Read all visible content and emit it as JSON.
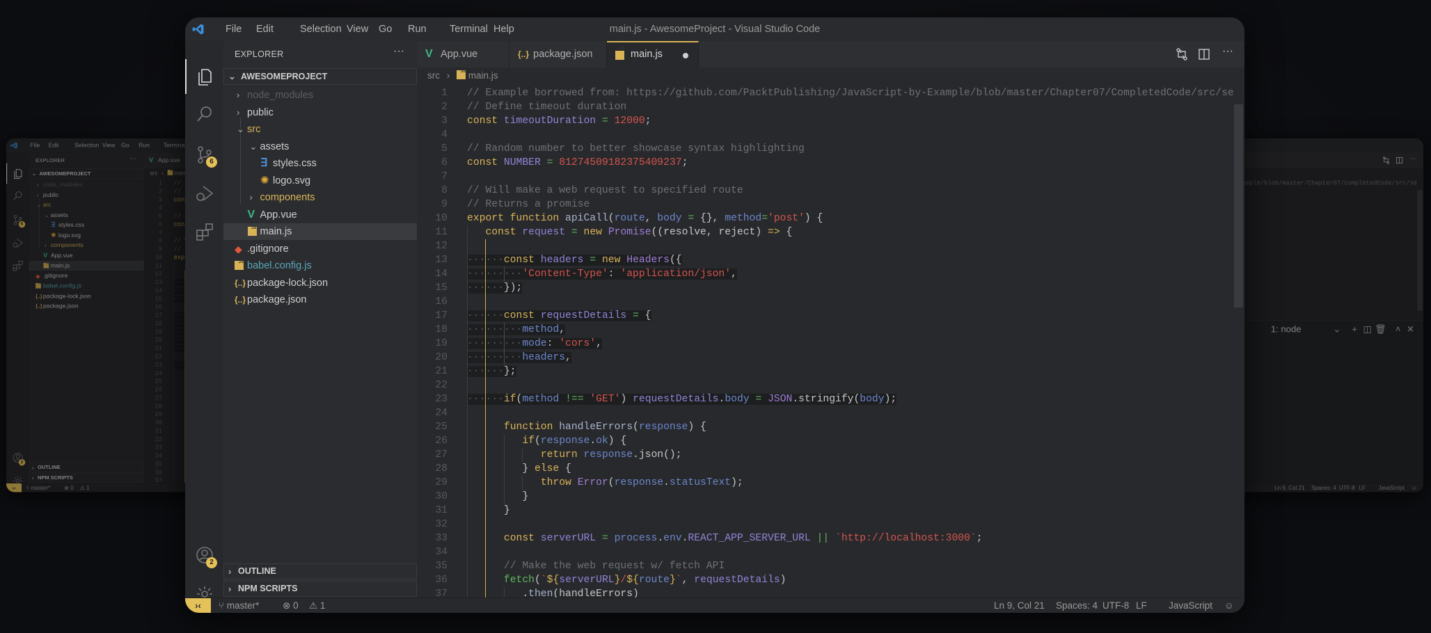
{
  "window": {
    "title": "main.js - AwesomeProject - Visual Studio Code"
  },
  "menu": [
    "File",
    "Edit",
    "Selection",
    "View",
    "Go",
    "Run",
    "Terminal",
    "Help"
  ],
  "activity_bar": {
    "items": [
      {
        "icon": "files-icon",
        "active": true
      },
      {
        "icon": "search-icon"
      },
      {
        "icon": "source-control-icon",
        "badge": "6"
      },
      {
        "icon": "run-debug-icon"
      },
      {
        "icon": "extensions-icon"
      }
    ],
    "bottom": [
      {
        "icon": "account-icon",
        "badge": "2"
      },
      {
        "icon": "gear-icon"
      }
    ]
  },
  "sidebar": {
    "title": "EXPLORER",
    "more": "···",
    "project": "AWESOMEPROJECT",
    "tree": [
      {
        "label": "node_modules",
        "type": "folder",
        "open": false,
        "level": 0,
        "color": "#5a5d62"
      },
      {
        "label": "public",
        "type": "folder",
        "open": false,
        "level": 0
      },
      {
        "label": "src",
        "type": "folder",
        "open": true,
        "level": 0,
        "color": "#d9b45a"
      },
      {
        "label": "assets",
        "type": "folder",
        "open": true,
        "level": 1
      },
      {
        "label": "styles.css",
        "type": "css",
        "level": 2
      },
      {
        "label": "logo.svg",
        "type": "svg",
        "level": 2
      },
      {
        "label": "components",
        "type": "folder",
        "open": false,
        "level": 1,
        "color": "#d9b45a"
      },
      {
        "label": "App.vue",
        "type": "vue",
        "level": 1
      },
      {
        "label": "main.js",
        "type": "js",
        "level": 1,
        "selected": true
      },
      {
        "label": ".gitignore",
        "type": "git",
        "level": 0
      },
      {
        "label": "babel.config.js",
        "type": "js",
        "level": 0,
        "color": "#5aa6b3"
      },
      {
        "label": "package-lock.json",
        "type": "json",
        "level": 0
      },
      {
        "label": "package.json",
        "type": "json",
        "level": 0
      }
    ],
    "panels": [
      "OUTLINE",
      "NPM SCRIPTS"
    ]
  },
  "tabs": [
    {
      "label": "App.vue",
      "type": "vue"
    },
    {
      "label": "package.json",
      "type": "json"
    },
    {
      "label": "main.js",
      "type": "js",
      "active": true,
      "modified": true
    }
  ],
  "breadcrumb": [
    "src",
    "main.js"
  ],
  "editor": {
    "lines": [
      [
        [
          "c",
          "// Example borrowed from: https://github.com/PacktPublishing/JavaScript-by-Example/blob/master/Chapter07/CompletedCode/src/se"
        ]
      ],
      [
        [
          "c",
          "// Define timeout duration"
        ]
      ],
      [
        [
          "k",
          "const"
        ],
        [
          "p",
          " "
        ],
        [
          "v",
          "timeoutDuration"
        ],
        [
          "p",
          " "
        ],
        [
          "o",
          "="
        ],
        [
          "p",
          " "
        ],
        [
          "n",
          "12000"
        ],
        [
          "p",
          ";"
        ]
      ],
      [],
      [
        [
          "c",
          "// Random number to better showcase syntax highlighting"
        ]
      ],
      [
        [
          "k",
          "const"
        ],
        [
          "p",
          " "
        ],
        [
          "v",
          "NUMBER"
        ],
        [
          "p",
          " "
        ],
        [
          "o",
          "="
        ],
        [
          "p",
          " "
        ],
        [
          "n",
          "81274509182375409237"
        ],
        [
          "p",
          ";"
        ]
      ],
      [],
      [
        [
          "c",
          "// Will make a web request to specified route"
        ]
      ],
      [
        [
          "c",
          "// Returns a promise"
        ]
      ],
      [
        [
          "k",
          "export function"
        ],
        [
          "p",
          " "
        ],
        [
          "f",
          "apiCall"
        ],
        [
          "p",
          "("
        ],
        [
          "t",
          "route"
        ],
        [
          "p",
          ", "
        ],
        [
          "t",
          "body"
        ],
        [
          "p",
          " "
        ],
        [
          "o",
          "="
        ],
        [
          "p",
          " {}, "
        ],
        [
          "t",
          "method"
        ],
        [
          "o",
          "="
        ],
        [
          "n",
          "'post'"
        ],
        [
          "p",
          ") {"
        ]
      ],
      [
        [
          "ws",
          "   "
        ],
        [
          "k",
          "const"
        ],
        [
          "p",
          " "
        ],
        [
          "v",
          "request"
        ],
        [
          "p",
          " "
        ],
        [
          "o",
          "="
        ],
        [
          "p",
          " "
        ],
        [
          "k",
          "new"
        ],
        [
          "p",
          " "
        ],
        [
          "cl2",
          "Promise"
        ],
        [
          "p",
          "((resolve, reject) "
        ],
        [
          "k",
          "=>"
        ],
        [
          "p",
          " {"
        ]
      ],
      [],
      [
        [
          "ws",
          "      "
        ],
        [
          "k",
          "const"
        ],
        [
          "p",
          " "
        ],
        [
          "v",
          "headers"
        ],
        [
          "p",
          " "
        ],
        [
          "o",
          "="
        ],
        [
          "p",
          " "
        ],
        [
          "k",
          "new"
        ],
        [
          "p",
          " "
        ],
        [
          "cl2",
          "Headers"
        ],
        [
          "p",
          "({"
        ]
      ],
      [
        [
          "ws",
          "         "
        ],
        [
          "n",
          "'Content-Type'"
        ],
        [
          "p",
          ": "
        ],
        [
          "n",
          "'application/json'"
        ],
        [
          "p",
          ","
        ]
      ],
      [
        [
          "ws",
          "      "
        ],
        [
          "p",
          "});"
        ]
      ],
      [],
      [
        [
          "ws",
          "      "
        ],
        [
          "k",
          "const"
        ],
        [
          "p",
          " "
        ],
        [
          "v",
          "requestDetails"
        ],
        [
          "p",
          " "
        ],
        [
          "o",
          "="
        ],
        [
          "p",
          " {"
        ]
      ],
      [
        [
          "ws",
          "         "
        ],
        [
          "t",
          "method"
        ],
        [
          "p",
          ","
        ]
      ],
      [
        [
          "ws",
          "         "
        ],
        [
          "t",
          "mode"
        ],
        [
          "p",
          ": "
        ],
        [
          "n",
          "'cors'"
        ],
        [
          "p",
          ","
        ]
      ],
      [
        [
          "ws",
          "         "
        ],
        [
          "t",
          "headers"
        ],
        [
          "p",
          ","
        ]
      ],
      [
        [
          "ws",
          "      "
        ],
        [
          "p",
          "};"
        ]
      ],
      [],
      [
        [
          "ws",
          "      "
        ],
        [
          "k",
          "if"
        ],
        [
          "p",
          "("
        ],
        [
          "t",
          "method"
        ],
        [
          "p",
          " "
        ],
        [
          "o",
          "!=="
        ],
        [
          "p",
          " "
        ],
        [
          "n",
          "'GET'"
        ],
        [
          "p",
          ") "
        ],
        [
          "v",
          "requestDetails"
        ],
        [
          "p",
          "."
        ],
        [
          "t",
          "body"
        ],
        [
          "p",
          " "
        ],
        [
          "o",
          "="
        ],
        [
          "p",
          " "
        ],
        [
          "cl2",
          "JSON"
        ],
        [
          "p",
          ".stringify("
        ],
        [
          "t",
          "body"
        ],
        [
          "p",
          ");"
        ]
      ],
      [],
      [
        [
          "ws",
          "      "
        ],
        [
          "k",
          "function"
        ],
        [
          "p",
          " "
        ],
        [
          "f",
          "handleErrors"
        ],
        [
          "p",
          "("
        ],
        [
          "t",
          "response"
        ],
        [
          "p",
          ") {"
        ]
      ],
      [
        [
          "ws",
          "         "
        ],
        [
          "k",
          "if"
        ],
        [
          "p",
          "("
        ],
        [
          "t",
          "response"
        ],
        [
          "p",
          "."
        ],
        [
          "t",
          "ok"
        ],
        [
          "p",
          ") {"
        ]
      ],
      [
        [
          "ws",
          "            "
        ],
        [
          "k",
          "return"
        ],
        [
          "p",
          " "
        ],
        [
          "t",
          "response"
        ],
        [
          "p",
          ".json();"
        ]
      ],
      [
        [
          "ws",
          "         "
        ],
        [
          "p",
          "} "
        ],
        [
          "k",
          "else"
        ],
        [
          "p",
          " {"
        ]
      ],
      [
        [
          "ws",
          "            "
        ],
        [
          "k",
          "throw"
        ],
        [
          "p",
          " "
        ],
        [
          "cl2",
          "Error"
        ],
        [
          "p",
          "("
        ],
        [
          "t",
          "response"
        ],
        [
          "p",
          "."
        ],
        [
          "t",
          "statusText"
        ],
        [
          "p",
          ");"
        ]
      ],
      [
        [
          "ws",
          "         "
        ],
        [
          "p",
          "}"
        ]
      ],
      [
        [
          "ws",
          "      "
        ],
        [
          "p",
          "}"
        ]
      ],
      [],
      [
        [
          "ws",
          "      "
        ],
        [
          "k",
          "const"
        ],
        [
          "p",
          " "
        ],
        [
          "v",
          "serverURL"
        ],
        [
          "p",
          " "
        ],
        [
          "o",
          "="
        ],
        [
          "p",
          " "
        ],
        [
          "t",
          "process"
        ],
        [
          "p",
          "."
        ],
        [
          "t",
          "env"
        ],
        [
          "p",
          "."
        ],
        [
          "v",
          "REACT_APP_SERVER_URL"
        ],
        [
          "p",
          " "
        ],
        [
          "o",
          "||"
        ],
        [
          "p",
          " "
        ],
        [
          "n",
          "`http://localhost:3000`"
        ],
        [
          "p",
          ";"
        ]
      ],
      [],
      [
        [
          "ws",
          "      "
        ],
        [
          "c",
          "// Make the web request w/ fetch API"
        ]
      ],
      [
        [
          "ws",
          "      "
        ],
        [
          "g",
          "fetch"
        ],
        [
          "p",
          "("
        ],
        [
          "n",
          "`"
        ],
        [
          "y",
          "${"
        ],
        [
          "v",
          "serverURL"
        ],
        [
          "y",
          "}"
        ],
        [
          "n",
          "/"
        ],
        [
          "y",
          "${"
        ],
        [
          "t",
          "route"
        ],
        [
          "y",
          "}"
        ],
        [
          "n",
          "`"
        ],
        [
          "p",
          ", "
        ],
        [
          "v",
          "requestDetails"
        ],
        [
          "p",
          ")"
        ]
      ],
      [
        [
          "ws",
          "         "
        ],
        [
          "p",
          "."
        ],
        [
          "f",
          "then"
        ],
        [
          "p",
          "(handleErrors)"
        ]
      ]
    ],
    "selected_lines": [
      13,
      14,
      15,
      17,
      18,
      19,
      20,
      21,
      23
    ]
  },
  "terminal": {
    "tab": "1: node"
  },
  "status_bar": {
    "branch": "master*",
    "errors": "0",
    "warnings": "1",
    "cursor": "Ln 9, Col 21",
    "spaces": "Spaces: 4",
    "encoding": "UTF-8",
    "eol": "LF",
    "language": "JavaScript"
  },
  "colors": {
    "accent": "#e5c15a",
    "background": "#0d0e12",
    "window": "#28292c"
  }
}
